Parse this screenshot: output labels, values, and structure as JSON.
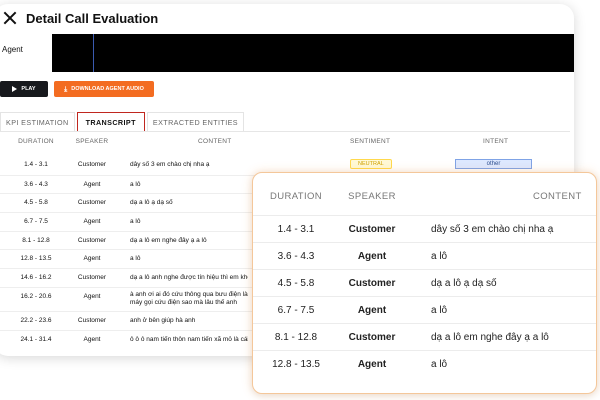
{
  "header": {
    "title": "Detail Call Evaluation"
  },
  "audio": {
    "agent_label": "Agent"
  },
  "buttons": {
    "play": "PLAY",
    "download": "DOWNLOAD AGENT AUDIO"
  },
  "tabs": [
    {
      "label": "KPI ESTIMATION",
      "active": false
    },
    {
      "label": "TRANSCRIPT",
      "active": true
    },
    {
      "label": "EXTRACTED ENTITIES",
      "active": false
    }
  ],
  "table": {
    "columns": {
      "duration": "DURATION",
      "speaker": "SPEAKER",
      "content": "CONTENT",
      "sentiment": "SENTIMENT",
      "intent": "INTENT"
    },
    "rows": [
      {
        "duration": "1.4 - 3.1",
        "speaker": "Customer",
        "content": "dây số 3 em chào chị nha ạ",
        "sentiment": "NEUTRAL",
        "intent": "other"
      },
      {
        "duration": "3.6 - 4.3",
        "speaker": "Agent",
        "content": "a lô"
      },
      {
        "duration": "4.5 - 5.8",
        "speaker": "Customer",
        "content": "dạ a lô ạ dạ số"
      },
      {
        "duration": "6.7 - 7.5",
        "speaker": "Agent",
        "content": "a lô"
      },
      {
        "duration": "8.1 - 12.8",
        "speaker": "Customer",
        "content": "dạ a lô em nghe đây ạ a lô"
      },
      {
        "duration": "12.8 - 13.5",
        "speaker": "Agent",
        "content": "a lô"
      },
      {
        "duration": "14.6 - 16.2",
        "speaker": "Customer",
        "content": "dạ a lô anh nghe được tín hiệu thì em không"
      },
      {
        "duration": "16.2 - 20.6",
        "speaker": "Agent",
        "content": "à anh ơi ai đó cứu thông qua bưu điện là máy gọi cứu điện sao mà lâu thế anh"
      },
      {
        "duration": "22.2 - 23.6",
        "speaker": "Customer",
        "content": "anh ở bên giúp hà anh"
      },
      {
        "duration": "24.1 - 31.4",
        "speaker": "Agent",
        "content": "ô ô ô nam tiến thôn nam tiến xã mỏ là cái"
      }
    ]
  },
  "zoom": {
    "columns": {
      "duration": "DURATION",
      "speaker": "SPEAKER",
      "content": "CONTENT"
    },
    "rows": [
      {
        "duration": "1.4 - 3.1",
        "speaker": "Customer",
        "content": "dây số 3 em chào chị nha ạ"
      },
      {
        "duration": "3.6 - 4.3",
        "speaker": "Agent",
        "content": "a lô"
      },
      {
        "duration": "4.5 - 5.8",
        "speaker": "Customer",
        "content": "dạ a lô ạ dạ số"
      },
      {
        "duration": "6.7 - 7.5",
        "speaker": "Agent",
        "content": "a lô"
      },
      {
        "duration": "8.1 - 12.8",
        "speaker": "Customer",
        "content": "dạ a lô em nghe đây ạ a lô"
      },
      {
        "duration": "12.8 - 13.5",
        "speaker": "Agent",
        "content": "a lô"
      }
    ]
  },
  "colors": {
    "download_button": "#f36c21",
    "play_button": "#17191d",
    "active_tab_border": "#c0271f",
    "zoom_border": "#f4c79a"
  }
}
